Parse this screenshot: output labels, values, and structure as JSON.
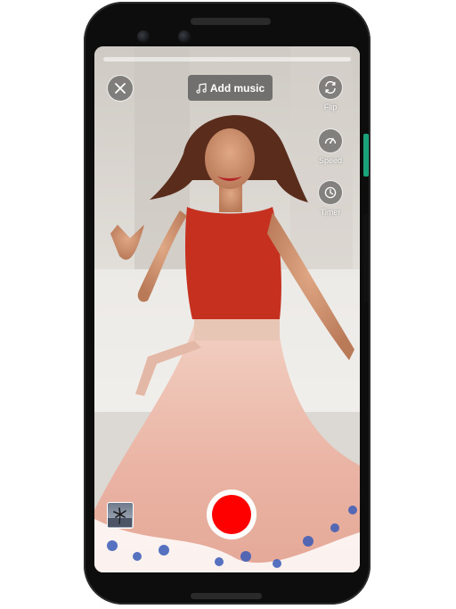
{
  "top_bar": {
    "add_music_label": "Add music",
    "close_icon": "close-icon",
    "music_icon": "music-note-icon"
  },
  "tools": [
    {
      "label": "Flip",
      "icon": "flip-camera-icon"
    },
    {
      "label": "Speed",
      "icon": "speedometer-icon"
    },
    {
      "label": "Timer",
      "icon": "clock-icon"
    }
  ],
  "bottom_bar": {
    "gallery_icon": "gallery-thumbnail",
    "record_icon": "record-button"
  },
  "colors": {
    "record": "#ff0000",
    "control_bg": "rgba(55,55,55,0.6)",
    "phone_body": "#0d0d0d",
    "side_button_accent": "#1aa37a"
  }
}
